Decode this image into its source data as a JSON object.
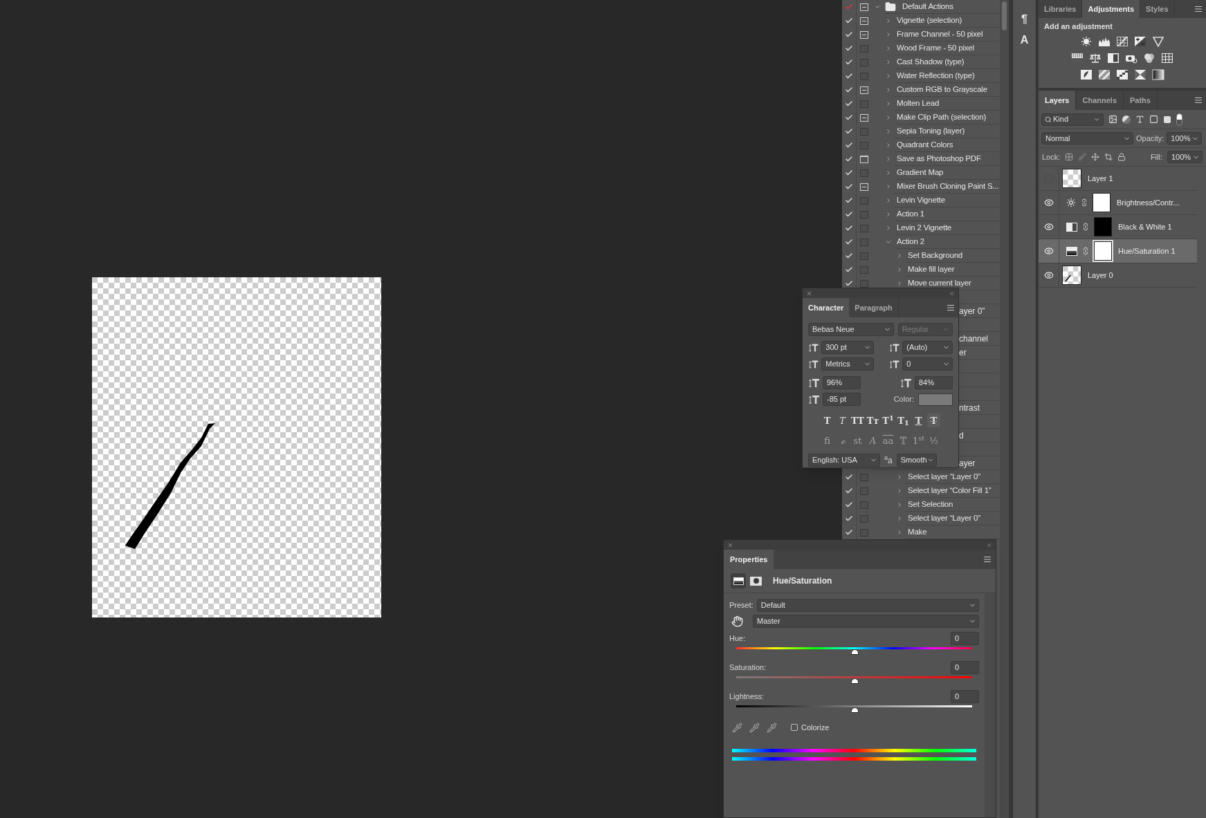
{
  "actions": {
    "items": [
      {
        "kind": "set",
        "name": "Default Actions",
        "checked": true,
        "check_mixed": true,
        "dialog": true,
        "dialog_mixed": true,
        "expanded": true,
        "children": [
          {
            "kind": "action",
            "name": "Vignette (selection)",
            "checked": true,
            "check_mixed": false,
            "dialog": true,
            "dialog_mixed": true,
            "expanded": false
          },
          {
            "kind": "action",
            "name": "Frame Channel - 50 pixel",
            "checked": true,
            "check_mixed": false,
            "dialog": true,
            "dialog_mixed": true,
            "expanded": false
          },
          {
            "kind": "action",
            "name": "Wood Frame - 50 pixel",
            "checked": true,
            "check_mixed": false,
            "dialog": false,
            "dialog_mixed": false,
            "expanded": false
          },
          {
            "kind": "action",
            "name": "Cast Shadow (type)",
            "checked": true,
            "check_mixed": false,
            "dialog": false,
            "dialog_mixed": false,
            "expanded": false
          },
          {
            "kind": "action",
            "name": "Water Reflection (type)",
            "checked": true,
            "check_mixed": false,
            "dialog": false,
            "dialog_mixed": false,
            "expanded": false
          },
          {
            "kind": "action",
            "name": "Custom RGB to Grayscale",
            "checked": true,
            "check_mixed": false,
            "dialog": true,
            "dialog_mixed": true,
            "expanded": false
          },
          {
            "kind": "action",
            "name": "Molten Lead",
            "checked": true,
            "check_mixed": false,
            "dialog": false,
            "dialog_mixed": false,
            "expanded": false
          },
          {
            "kind": "action",
            "name": "Make Clip Path (selection)",
            "checked": true,
            "check_mixed": false,
            "dialog": true,
            "dialog_mixed": true,
            "expanded": false
          },
          {
            "kind": "action",
            "name": "Sepia Toning (layer)",
            "checked": true,
            "check_mixed": false,
            "dialog": false,
            "dialog_mixed": false,
            "expanded": false
          },
          {
            "kind": "action",
            "name": "Quadrant Colors",
            "checked": true,
            "check_mixed": false,
            "dialog": false,
            "dialog_mixed": false,
            "expanded": false
          },
          {
            "kind": "action",
            "name": "Save as Photoshop PDF",
            "checked": true,
            "check_mixed": false,
            "dialog": true,
            "dialog_mixed": false,
            "expanded": false
          },
          {
            "kind": "action",
            "name": "Gradient Map",
            "checked": true,
            "check_mixed": false,
            "dialog": false,
            "dialog_mixed": false,
            "expanded": false
          },
          {
            "kind": "action",
            "name": "Mixer Brush Cloning Paint S...",
            "checked": true,
            "check_mixed": false,
            "dialog": true,
            "dialog_mixed": true,
            "expanded": false
          },
          {
            "kind": "action",
            "name": "Levin Vignette",
            "checked": true,
            "check_mixed": false,
            "dialog": false,
            "dialog_mixed": false,
            "expanded": false
          },
          {
            "kind": "action",
            "name": "Action 1",
            "checked": true,
            "check_mixed": false,
            "dialog": false,
            "dialog_mixed": false,
            "expanded": false
          },
          {
            "kind": "action",
            "name": "Levin 2 Vignette",
            "checked": true,
            "check_mixed": false,
            "dialog": false,
            "dialog_mixed": false,
            "expanded": false
          },
          {
            "kind": "action",
            "name": "Action 2",
            "checked": true,
            "check_mixed": false,
            "dialog": false,
            "dialog_mixed": false,
            "expanded": true,
            "children": [
              {
                "kind": "step",
                "name": "Set Background",
                "checked": true,
                "check_mixed": false,
                "dialog": false,
                "dialog_mixed": false,
                "expanded": false
              },
              {
                "kind": "step",
                "name": "Make fill layer",
                "checked": true,
                "check_mixed": false,
                "dialog": false,
                "dialog_mixed": false,
                "expanded": false
              },
              {
                "kind": "step",
                "name": "Move current layer",
                "checked": true,
                "check_mixed": false,
                "dialog": false,
                "dialog_mixed": false,
                "expanded": false
              },
              {
                "kind": "hidden"
              },
              {
                "kind": "covered",
                "name": "ayer 0”"
              },
              {
                "kind": "hidden"
              },
              {
                "kind": "covered",
                "name": "channel"
              },
              {
                "kind": "covered",
                "name": "er"
              },
              {
                "kind": "hidden"
              },
              {
                "kind": "hidden"
              },
              {
                "kind": "hidden"
              },
              {
                "kind": "covered",
                "name": "ntrast"
              },
              {
                "kind": "hidden"
              },
              {
                "kind": "covered",
                "name": "d"
              },
              {
                "kind": "hidden"
              },
              {
                "kind": "covered",
                "name": "ayer"
              },
              {
                "kind": "step",
                "name": "Select layer “Layer 0”",
                "checked": true,
                "check_mixed": false,
                "dialog": false,
                "dialog_mixed": false,
                "expanded": false
              },
              {
                "kind": "step",
                "name": "Select layer “Color Fill 1”",
                "checked": true,
                "check_mixed": false,
                "dialog": false,
                "dialog_mixed": false,
                "expanded": false
              },
              {
                "kind": "step",
                "name": "Set Selection",
                "checked": true,
                "check_mixed": false,
                "dialog": false,
                "dialog_mixed": false,
                "expanded": false
              },
              {
                "kind": "step",
                "name": "Select layer “Layer 0”",
                "checked": true,
                "check_mixed": false,
                "dialog": false,
                "dialog_mixed": false,
                "expanded": false
              },
              {
                "kind": "step",
                "name": "Make",
                "checked": true,
                "check_mixed": false,
                "dialog": false,
                "dialog_mixed": false,
                "expanded": false
              }
            ]
          }
        ]
      }
    ]
  },
  "tool_strip": [
    "¶",
    "A"
  ],
  "adjustments": {
    "tabs": [
      {
        "label": "Libraries",
        "selected": false
      },
      {
        "label": "Adjustments",
        "selected": true
      },
      {
        "label": "Styles",
        "selected": false
      }
    ],
    "heading": "Add an adjustment"
  },
  "layers": {
    "tabs": [
      {
        "label": "Layers",
        "selected": true
      },
      {
        "label": "Channels",
        "selected": false
      },
      {
        "label": "Paths",
        "selected": false
      }
    ],
    "filter": "Kind",
    "blend_mode": "Normal",
    "opacity_label": "Opacity:",
    "opacity": "100%",
    "lock_label": "Lock:",
    "fill_label": "Fill:",
    "fill": "100%",
    "items": [
      {
        "name": "Layer 1",
        "kind": "pixel",
        "thumb_drawn": false,
        "visible": false,
        "selected": false
      },
      {
        "name": "Brightness/Contr...",
        "kind": "brightness",
        "mask_dark": false,
        "visible": true,
        "selected": false
      },
      {
        "name": "Black & White 1",
        "kind": "bw",
        "mask_dark": true,
        "visible": true,
        "selected": false
      },
      {
        "name": "Hue/Saturation 1",
        "kind": "huesat",
        "mask_dark": false,
        "visible": true,
        "selected": true
      },
      {
        "name": "Layer 0",
        "kind": "pixel",
        "thumb_drawn": true,
        "visible": true,
        "selected": false
      }
    ]
  },
  "character": {
    "tabs": [
      {
        "label": "Character",
        "selected": true
      },
      {
        "label": "Paragraph",
        "selected": false
      }
    ],
    "font": "Bebas Neue",
    "style": "Regular",
    "size": "300 pt",
    "leading": "(Auto)",
    "kerning": "Metrics",
    "tracking": "0",
    "vertical_scale": "96%",
    "horizontal_scale": "84%",
    "baseline": "-85 pt",
    "color_label": "Color:",
    "color": "#7a7a7a",
    "styles": [
      {
        "glyph": "T",
        "kind": "bold"
      },
      {
        "glyph": "T",
        "kind": "italic"
      },
      {
        "glyph": "TT",
        "kind": "caps"
      },
      {
        "glyph": "Tᴛ",
        "kind": "smallcaps"
      },
      {
        "glyph": "T$^{1}$",
        "kind": "super"
      },
      {
        "glyph": "T$_{1}$",
        "kind": "sub"
      },
      {
        "glyph": "T",
        "kind": "underline"
      },
      {
        "glyph": "T",
        "kind": "strike"
      }
    ],
    "opentype": [
      {
        "glyph": "fi",
        "kind": "plain"
      },
      {
        "glyph": "ℴ",
        "kind": "italic"
      },
      {
        "glyph": "st",
        "kind": "plain"
      },
      {
        "glyph": "A",
        "kind": "italic"
      },
      {
        "glyph": "aa",
        "kind": "overline"
      },
      {
        "glyph": "T",
        "kind": "outline"
      },
      {
        "glyph": "1$^{st}$",
        "kind": "plain"
      },
      {
        "glyph": "½",
        "kind": "plain"
      }
    ],
    "language": "English: USA",
    "antialias_glyph": "$^{a}$a",
    "antialias": "Smooth"
  },
  "properties": {
    "tab": "Properties",
    "title": "Hue/Saturation",
    "preset_label": "Preset:",
    "preset": "Default",
    "channel": "Master",
    "sliders": [
      {
        "label": "Hue:",
        "value": "0",
        "kind": "hue",
        "level": 0.5
      },
      {
        "label": "Saturation:",
        "value": "0",
        "kind": "saturation",
        "level": 0.5
      },
      {
        "label": "Lightness:",
        "value": "0",
        "kind": "lightness",
        "level": 0.5
      }
    ],
    "colorize_label": "Colorize",
    "colorize": false
  }
}
